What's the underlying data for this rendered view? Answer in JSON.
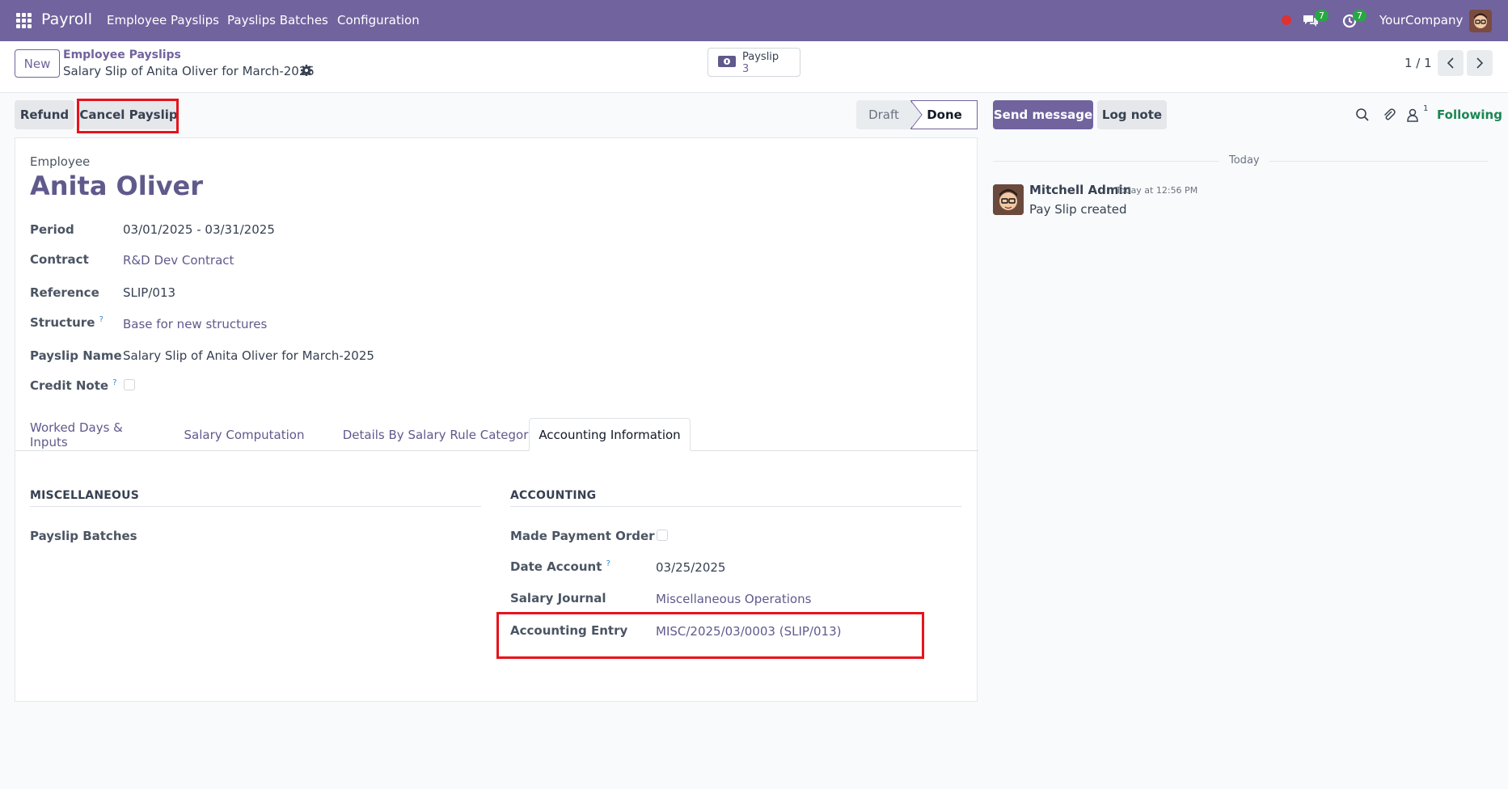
{
  "navbar": {
    "app_name": "Payroll",
    "menu": [
      "Employee Payslips",
      "Payslips Batches",
      "Configuration"
    ],
    "messages_badge": "7",
    "activities_badge": "7",
    "company": "YourCompany"
  },
  "control_panel": {
    "new_label": "New",
    "breadcrumb_parent": "Employee Payslips",
    "breadcrumb_current": "Salary Slip of Anita Oliver for March-2025",
    "smart_button": {
      "label": "Payslip",
      "value": "3"
    },
    "pager": "1 / 1"
  },
  "actions": {
    "refund_label": "Refund",
    "cancel_label": "Cancel Payslip"
  },
  "statusbar": {
    "states": [
      "Draft",
      "Done"
    ],
    "current": "Done"
  },
  "form": {
    "employee_label": "Employee",
    "employee_name": "Anita Oliver",
    "fields": {
      "period_label": "Period",
      "period_value": "03/01/2025 - 03/31/2025",
      "contract_label": "Contract",
      "contract_value": "R&D Dev Contract",
      "reference_label": "Reference",
      "reference_value": "SLIP/013",
      "structure_label": "Structure",
      "structure_value": "Base for new structures",
      "payslip_name_label": "Payslip Name",
      "payslip_name_value": "Salary Slip of Anita Oliver for March-2025",
      "credit_note_label": "Credit Note",
      "credit_note_checked": false
    },
    "tabs": [
      "Worked Days & Inputs",
      "Salary Computation",
      "Details By Salary Rule Category",
      "Accounting Information"
    ],
    "active_tab": "Accounting Information",
    "misc": {
      "title": "MISCELLANEOUS",
      "batches_label": "Payslip Batches",
      "batches_value": ""
    },
    "accounting": {
      "title": "ACCOUNTING",
      "payment_order_label": "Made Payment Order ?",
      "payment_order_checked": false,
      "date_account_label": "Date Account",
      "date_account_value": "03/25/2025",
      "journal_label": "Salary Journal",
      "journal_value": "Miscellaneous Operations",
      "entry_label": "Accounting Entry",
      "entry_value": "MISC/2025/03/0003 (SLIP/013)"
    },
    "help_mark": "?"
  },
  "chatter": {
    "send_message_label": "Send message",
    "log_note_label": "Log note",
    "follower_count": "1",
    "following_label": "Following",
    "date_separator": "Today",
    "messages": [
      {
        "author": "Mitchell Admin",
        "time": "Today at 12:56 PM",
        "body": "Pay Slip created"
      }
    ]
  },
  "colors": {
    "brand": "#71639e",
    "highlight": "#e8121c",
    "following": "#198754",
    "badge": "#28a745"
  }
}
